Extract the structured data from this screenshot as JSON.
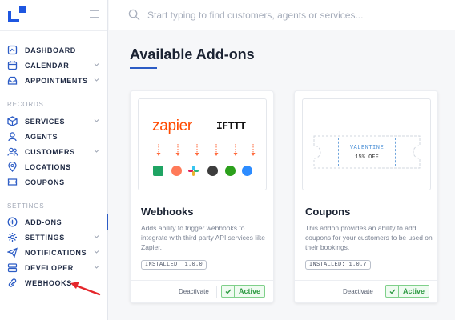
{
  "search": {
    "placeholder": "Start typing to find customers, agents or services..."
  },
  "nav_main": [
    {
      "label": "DASHBOARD",
      "icon": "dashboard-icon",
      "chevron": false
    },
    {
      "label": "CALENDAR",
      "icon": "calendar-icon",
      "chevron": true
    },
    {
      "label": "APPOINTMENTS",
      "icon": "inbox-icon",
      "chevron": true
    }
  ],
  "sections": {
    "records": "RECORDS",
    "settings": "SETTINGS"
  },
  "nav_records": [
    {
      "label": "SERVICES",
      "icon": "box-icon",
      "chevron": true
    },
    {
      "label": "AGENTS",
      "icon": "agents-icon",
      "chevron": false
    },
    {
      "label": "CUSTOMERS",
      "icon": "customers-icon",
      "chevron": true
    },
    {
      "label": "LOCATIONS",
      "icon": "location-pin-icon",
      "chevron": false
    },
    {
      "label": "COUPONS",
      "icon": "ticket-icon",
      "chevron": false
    }
  ],
  "nav_settings": [
    {
      "label": "ADD-ONS",
      "icon": "plus-circle-icon",
      "chevron": false,
      "active": true
    },
    {
      "label": "SETTINGS",
      "icon": "gear-icon",
      "chevron": true
    },
    {
      "label": "NOTIFICATIONS",
      "icon": "paper-plane-icon",
      "chevron": true
    },
    {
      "label": "DEVELOPER",
      "icon": "server-icon",
      "chevron": true
    },
    {
      "label": "WEBHOOKS",
      "icon": "link-icon",
      "chevron": false
    }
  ],
  "main": {
    "title": "Available Add-ons"
  },
  "cards": [
    {
      "name": "Webhooks",
      "description": "Adds ability to trigger webhooks to integrate with third party API services like Zapier.",
      "badge": "INSTALLED: 1.0.0",
      "deactivate_label": "Deactivate",
      "active_label": "Active",
      "image": {
        "logo_left": "zapier",
        "logo_right": "IFTTT"
      }
    },
    {
      "name": "Coupons",
      "description": "This addon provides an ability to add coupons for your customers to be used on their bookings.",
      "badge": "INSTALLED: 1.0.7",
      "deactivate_label": "Deactivate",
      "active_label": "Active",
      "image": {
        "code": "VALENTINE",
        "discount": "15% OFF"
      }
    }
  ],
  "colors": {
    "accent": "#2c5cc5",
    "active_green": "#2e9b43",
    "zapier": "#ff4a00"
  }
}
